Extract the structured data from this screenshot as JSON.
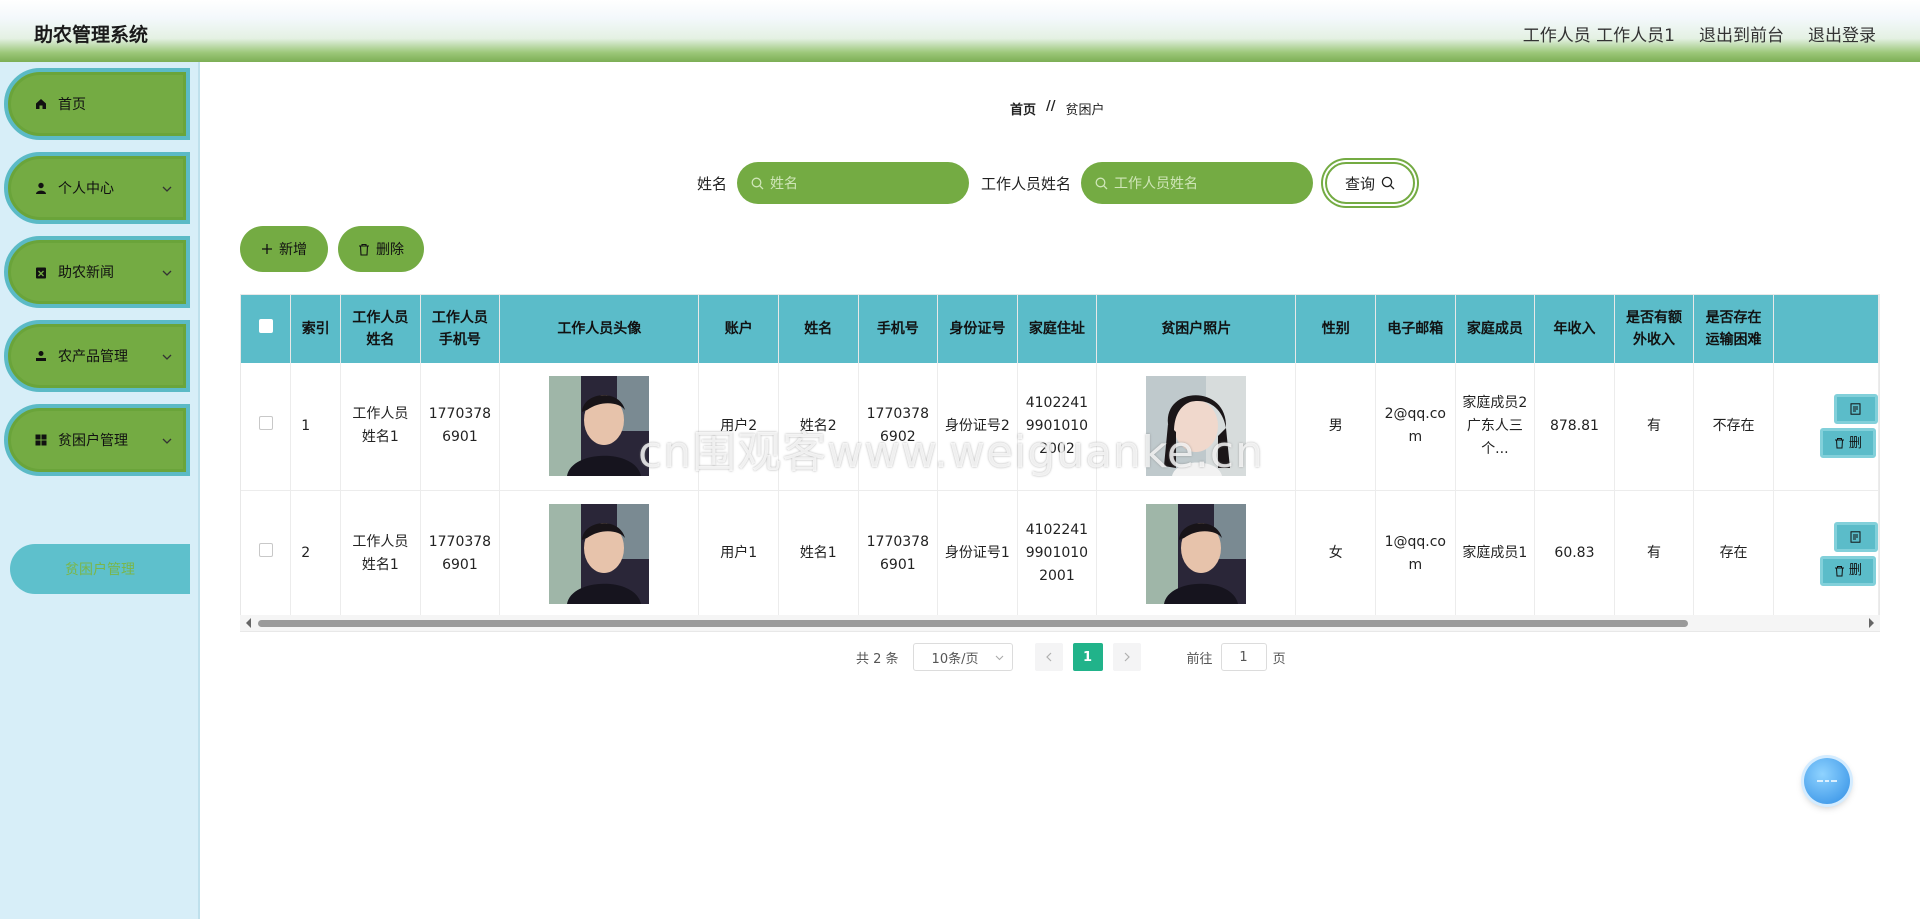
{
  "header": {
    "title": "助农管理系统",
    "nav": [
      "工作人员 工作人员1",
      "退出到前台",
      "退出登录"
    ]
  },
  "sidebar": {
    "items": [
      {
        "label": "首页",
        "icon": "home-icon"
      },
      {
        "label": "个人中心",
        "icon": "user-icon"
      },
      {
        "label": "助农新闻",
        "icon": "news-icon"
      },
      {
        "label": "农产品管理",
        "icon": "product-icon"
      },
      {
        "label": "贫困户管理",
        "icon": "grid-icon"
      }
    ],
    "submenu": "贫困户管理"
  },
  "breadcrumb": {
    "home": "首页",
    "sep": "//",
    "current": "贫困户"
  },
  "search": {
    "name_label": "姓名",
    "name_placeholder": "姓名",
    "staff_label": "工作人员姓名",
    "staff_placeholder": "工作人员姓名",
    "query_label": "查询"
  },
  "actions": {
    "add": "新增",
    "delete": "删除"
  },
  "table": {
    "headers": [
      "索引",
      "工作人员姓名",
      "工作人员手机号",
      "工作人员头像",
      "账户",
      "姓名",
      "手机号",
      "身份证号",
      "家庭住址",
      "贫困户照片",
      "性别",
      "电子邮箱",
      "家庭成员",
      "年收入",
      "是否有额外收入",
      "是否存在运输困难"
    ],
    "rows": [
      {
        "index": "1",
        "staff_name": "工作人员姓名1",
        "staff_phone": "17703786901",
        "account": "用户2",
        "name": "姓名2",
        "phone": "17703786902",
        "id_no": "身份证号2",
        "address": "410224199010102002",
        "gender": "男",
        "email": "2@qq.com",
        "family": "家庭成员2广东人三个...",
        "income": "878.81",
        "extra_income": "有",
        "transport": "不存在",
        "ops": [
          "",
          "删"
        ]
      },
      {
        "index": "2",
        "staff_name": "工作人员姓名1",
        "staff_phone": "17703786901",
        "account": "用户1",
        "name": "姓名1",
        "phone": "17703786901",
        "id_no": "身份证号1",
        "address": "410224199010102001",
        "gender": "女",
        "email": "1@qq.com",
        "family": "家庭成员1",
        "income": "60.83",
        "extra_income": "有",
        "transport": "存在",
        "ops": [
          "",
          "删"
        ]
      }
    ]
  },
  "pagination": {
    "total": "共 2 条",
    "page_size": "10条/页",
    "current": "1",
    "goto_label": "前往",
    "goto_value": "1",
    "page_unit": "页"
  },
  "watermark": "cn围观客www.weiguanke.cn",
  "colors": {
    "brand_green": "#74ab43",
    "teal": "#5bbcc9",
    "pager_active": "#21b38a"
  }
}
